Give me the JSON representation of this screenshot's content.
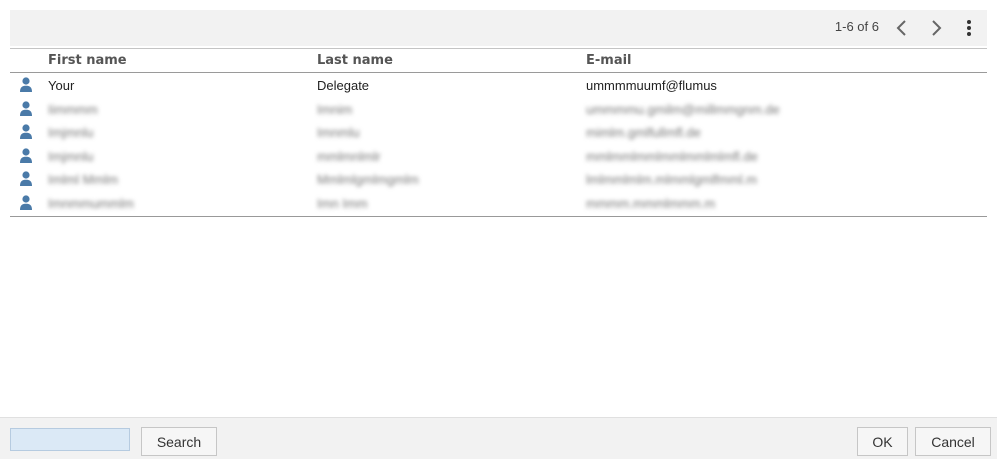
{
  "pager": {
    "text": "1-6 of 6"
  },
  "icons": {
    "prev": "chevron-left-icon",
    "next": "chevron-right-icon",
    "more": "more-vertical-icon",
    "row": "user-icon"
  },
  "columns": {
    "first": "First name",
    "last": "Last name",
    "email": "E-mail"
  },
  "rows": [
    {
      "first": "Your",
      "last": "Delegate",
      "email": "ummmmuumf@flumus",
      "blurred": false
    },
    {
      "first": "Iimmmm",
      "last": "Imnim",
      "email": "ummmmu.gmilm@millmmgnm.de",
      "blurred": true
    },
    {
      "first": "Imjmnlu",
      "last": "Imnmlu",
      "email": "mimlm.gmlfullmfl.de",
      "blurred": true
    },
    {
      "first": "Imjmnlu",
      "last": "mmlmnlmlr",
      "email": "mmlmmlmmlmmlmmlmlmfl.de",
      "blurred": true
    },
    {
      "first": "Imlml Mmlm",
      "last": "Mmlmlgmlmgmlm",
      "email": "lmlmmlmlm.mlmmlgmlfmml.m",
      "blurred": true
    },
    {
      "first": "Imnmmummlm",
      "last": "Imn Imm",
      "email": "mmmm.mmmlmmm.m",
      "blurred": true
    }
  ],
  "footer": {
    "search_placeholder": "",
    "search_label": "Search",
    "ok_label": "OK",
    "cancel_label": "Cancel"
  },
  "colors": {
    "accent": "#4a7aa8",
    "toolbar_bg": "#f2f2f2",
    "input_bg": "#dbe9f6"
  }
}
